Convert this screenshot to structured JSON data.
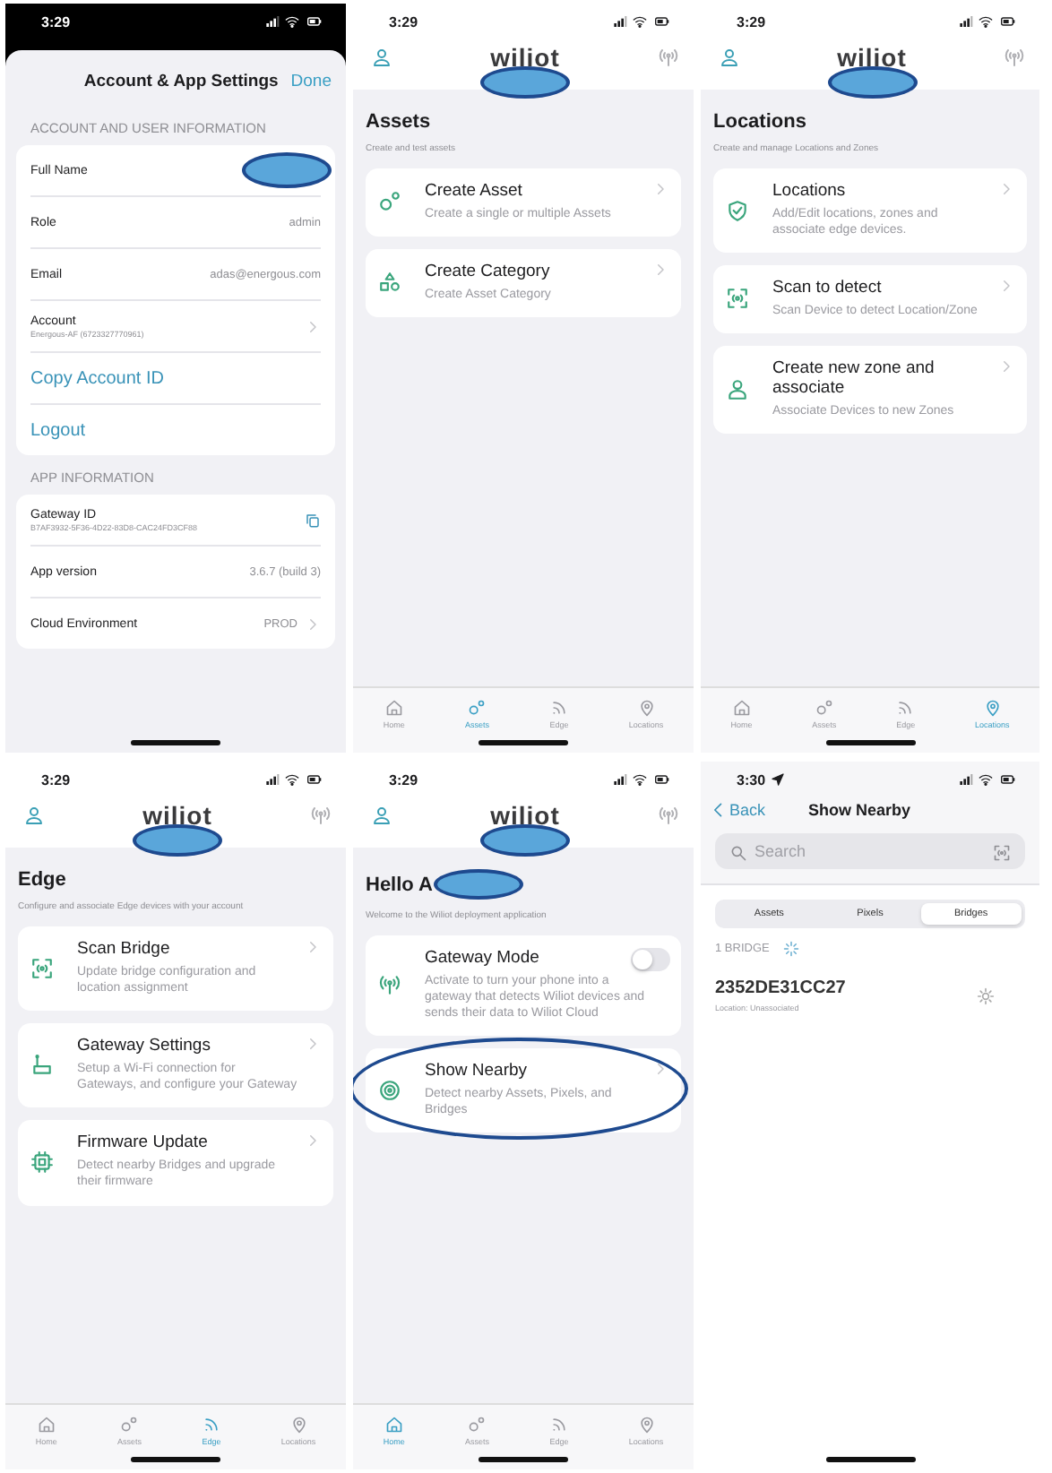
{
  "screens": [
    {
      "kind": "settings",
      "time": "3:29",
      "title": "Account & App Settings",
      "action": "Done",
      "sections": [
        {
          "header": "ACCOUNT AND USER INFORMATION",
          "rows": [
            {
              "kind": "field",
              "label": "Full Name",
              "redacted": true
            },
            {
              "kind": "field",
              "label": "Role",
              "value": "admin"
            },
            {
              "kind": "field",
              "label": "Email",
              "value": "adas@energous.com"
            },
            {
              "kind": "field",
              "label": "Account",
              "sub": "Energous-AF (6723327770961)",
              "disclosure": true
            },
            {
              "kind": "link",
              "label": "Copy Account ID"
            },
            {
              "kind": "link",
              "label": "Logout"
            }
          ]
        },
        {
          "header": "APP INFORMATION",
          "rows": [
            {
              "kind": "field",
              "label": "Gateway ID",
              "sub": "B7AF3932-5F36-4D22-83D8-CAC24FD3CF88",
              "copyable": true
            },
            {
              "kind": "field",
              "label": "App version",
              "value": "3.6.7 (build 3)"
            },
            {
              "kind": "field",
              "label": "Cloud Environment",
              "value": "PROD",
              "disclosure": true
            }
          ]
        }
      ]
    },
    {
      "kind": "menu",
      "time": "3:29",
      "logo": "wiliot",
      "logo_redacted": true,
      "title": "Assets",
      "subtitle": "Create and test assets",
      "cards": [
        {
          "kind": "link",
          "title": "Create Asset",
          "description": "Create a single or multiple Assets"
        },
        {
          "kind": "link",
          "title": "Create Category",
          "description": "Create Asset Category"
        }
      ],
      "tabs": [
        {
          "label": "Home",
          "selected": false
        },
        {
          "label": "Assets",
          "selected": true
        },
        {
          "label": "Edge",
          "selected": false
        },
        {
          "label": "Locations",
          "selected": false
        }
      ]
    },
    {
      "kind": "menu",
      "time": "3:29",
      "logo": "wiliot",
      "logo_redacted": true,
      "title": "Locations",
      "subtitle": "Create and manage Locations and Zones",
      "cards": [
        {
          "kind": "link",
          "title": "Locations",
          "description": "Add/Edit locations, zones and associate edge devices."
        },
        {
          "kind": "link",
          "title": "Scan to detect",
          "description": "Scan Device to detect Location/Zone"
        },
        {
          "kind": "link",
          "title": "Create new zone and associate",
          "description": "Associate Devices to new Zones"
        }
      ],
      "tabs": [
        {
          "label": "Home",
          "selected": false
        },
        {
          "label": "Assets",
          "selected": false
        },
        {
          "label": "Edge",
          "selected": false
        },
        {
          "label": "Locations",
          "selected": true
        }
      ]
    },
    {
      "kind": "menu",
      "time": "3:29",
      "logo": "wiliot",
      "logo_redacted": true,
      "title": "Edge",
      "subtitle": "Configure and associate Edge devices with your account",
      "cards": [
        {
          "kind": "link",
          "title": "Scan Bridge",
          "description": "Update bridge configuration and location assignment"
        },
        {
          "kind": "link",
          "title": "Gateway Settings",
          "description": "Setup a Wi-Fi connection for Gateways, and configure your Gateway"
        },
        {
          "kind": "link",
          "title": "Firmware Update",
          "description": "Detect nearby Bridges and upgrade their firmware"
        }
      ],
      "tabs": [
        {
          "label": "Home",
          "selected": false
        },
        {
          "label": "Assets",
          "selected": false
        },
        {
          "label": "Edge",
          "selected": true
        },
        {
          "label": "Locations",
          "selected": false
        }
      ]
    },
    {
      "kind": "menu",
      "time": "3:29",
      "logo": "wiliot",
      "logo_redacted": true,
      "title": "Hello A",
      "title_redacted": true,
      "subtitle": "Welcome to the Wiliot deployment application",
      "cards": [
        {
          "kind": "toggle",
          "title": "Gateway Mode",
          "description": "Activate to turn your phone into a gateway that detects Wiliot devices and sends their data to Wiliot Cloud",
          "on": false
        },
        {
          "kind": "link",
          "title": "Show Nearby",
          "description": "Detect nearby Assets, Pixels, and Bridges",
          "circled": true
        }
      ],
      "tabs": [
        {
          "label": "Home",
          "selected": true
        },
        {
          "label": "Assets",
          "selected": false
        },
        {
          "label": "Edge",
          "selected": false
        },
        {
          "label": "Locations",
          "selected": false
        }
      ]
    },
    {
      "kind": "nearby",
      "time": "3:30",
      "status_location": true,
      "back": "Back",
      "title": "Show Nearby",
      "search_placeholder": "Search",
      "segments": [
        {
          "label": "Assets",
          "selected": false
        },
        {
          "label": "Pixels",
          "selected": false
        },
        {
          "label": "Bridges",
          "selected": true
        }
      ],
      "count": "1 BRIDGE",
      "items": [
        {
          "id": "2352DE31CC27",
          "location": "Location: Unassociated"
        }
      ]
    }
  ]
}
